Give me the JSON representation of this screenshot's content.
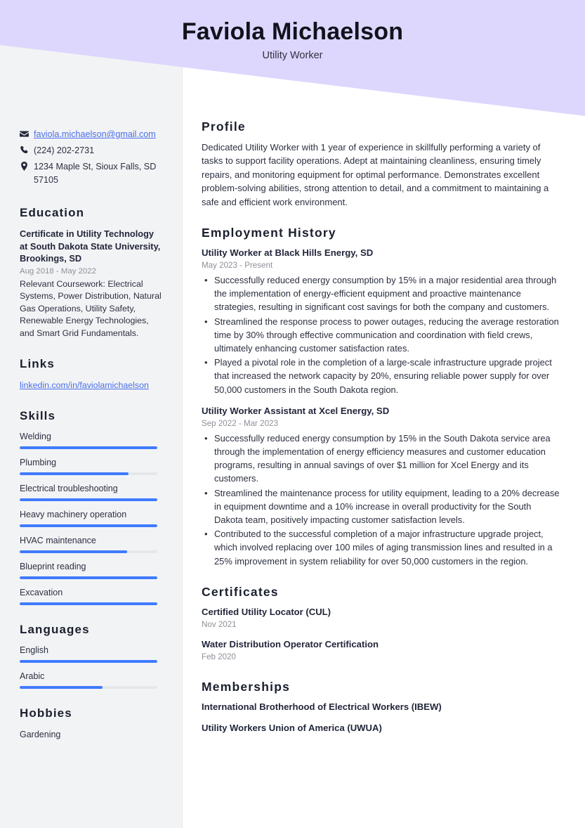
{
  "theme": {
    "header_bg": "#DDD6FD",
    "sidebar_bg": "#F2F3F5",
    "accent": "#407BFF",
    "link": "#4A6FE8",
    "heading": "#1B1F2E",
    "body_text": "#2C3040",
    "muted": "#8E9099"
  },
  "header": {
    "name": "Faviola Michaelson",
    "title": "Utility Worker"
  },
  "sidebar": {
    "contact": [
      {
        "icon": "envelope-icon",
        "text": "faviola.michaelson@gmail.com",
        "is_link": true
      },
      {
        "icon": "phone-icon",
        "text": "(224) 202-2731",
        "is_link": false
      },
      {
        "icon": "location-pin-icon",
        "text": "1234 Maple St, Sioux Falls, SD 57105",
        "is_link": false
      }
    ],
    "education": {
      "heading": "Education",
      "entries": [
        {
          "title": "Certificate in Utility Technology at South Dakota State University, Brookings, SD",
          "date": "Aug 2018 - May 2022",
          "description": "Relevant Coursework: Electrical Systems, Power Distribution, Natural Gas Operations, Utility Safety, Renewable Energy Technologies, and Smart Grid Fundamentals."
        }
      ]
    },
    "links": {
      "heading": "Links",
      "items": [
        {
          "label": "linkedin.com/in/faviolamichaelson"
        }
      ]
    },
    "skills": {
      "heading": "Skills",
      "items": [
        {
          "label": "Welding",
          "level": 100
        },
        {
          "label": "Plumbing",
          "level": 79
        },
        {
          "label": "Electrical troubleshooting",
          "level": 100
        },
        {
          "label": "Heavy machinery operation",
          "level": 100
        },
        {
          "label": "HVAC maintenance",
          "level": 78
        },
        {
          "label": "Blueprint reading",
          "level": 100
        },
        {
          "label": "Excavation",
          "level": 100
        }
      ]
    },
    "languages": {
      "heading": "Languages",
      "items": [
        {
          "label": "English",
          "level": 100
        },
        {
          "label": "Arabic",
          "level": 60
        }
      ]
    },
    "hobbies": {
      "heading": "Hobbies",
      "items": [
        {
          "label": "Gardening"
        }
      ]
    }
  },
  "main": {
    "profile": {
      "heading": "Profile",
      "text": "Dedicated Utility Worker with 1 year of experience in skillfully performing a variety of tasks to support facility operations. Adept at maintaining cleanliness, ensuring timely repairs, and monitoring equipment for optimal performance. Demonstrates excellent problem-solving abilities, strong attention to detail, and a commitment to maintaining a safe and efficient work environment."
    },
    "employment": {
      "heading": "Employment History",
      "jobs": [
        {
          "title": "Utility Worker at Black Hills Energy, SD",
          "date": "May 2023 - Present",
          "bullets": [
            "Successfully reduced energy consumption by 15% in a major residential area through the implementation of energy-efficient equipment and proactive maintenance strategies, resulting in significant cost savings for both the company and customers.",
            "Streamlined the response process to power outages, reducing the average restoration time by 30% through effective communication and coordination with field crews, ultimately enhancing customer satisfaction rates.",
            "Played a pivotal role in the completion of a large-scale infrastructure upgrade project that increased the network capacity by 20%, ensuring reliable power supply for over 50,000 customers in the South Dakota region."
          ]
        },
        {
          "title": "Utility Worker Assistant at Xcel Energy, SD",
          "date": "Sep 2022 - Mar 2023",
          "bullets": [
            "Successfully reduced energy consumption by 15% in the South Dakota service area through the implementation of energy efficiency measures and customer education programs, resulting in annual savings of over $1 million for Xcel Energy and its customers.",
            "Streamlined the maintenance process for utility equipment, leading to a 20% decrease in equipment downtime and a 10% increase in overall productivity for the South Dakota team, positively impacting customer satisfaction levels.",
            "Contributed to the successful completion of a major infrastructure upgrade project, which involved replacing over 100 miles of aging transmission lines and resulted in a 25% improvement in system reliability for over 50,000 customers in the region."
          ]
        }
      ]
    },
    "certificates": {
      "heading": "Certificates",
      "items": [
        {
          "title": "Certified Utility Locator (CUL)",
          "date": "Nov 2021"
        },
        {
          "title": "Water Distribution Operator Certification",
          "date": "Feb 2020"
        }
      ]
    },
    "memberships": {
      "heading": "Memberships",
      "items": [
        {
          "title": "International Brotherhood of Electrical Workers (IBEW)"
        },
        {
          "title": "Utility Workers Union of America (UWUA)"
        }
      ]
    }
  }
}
